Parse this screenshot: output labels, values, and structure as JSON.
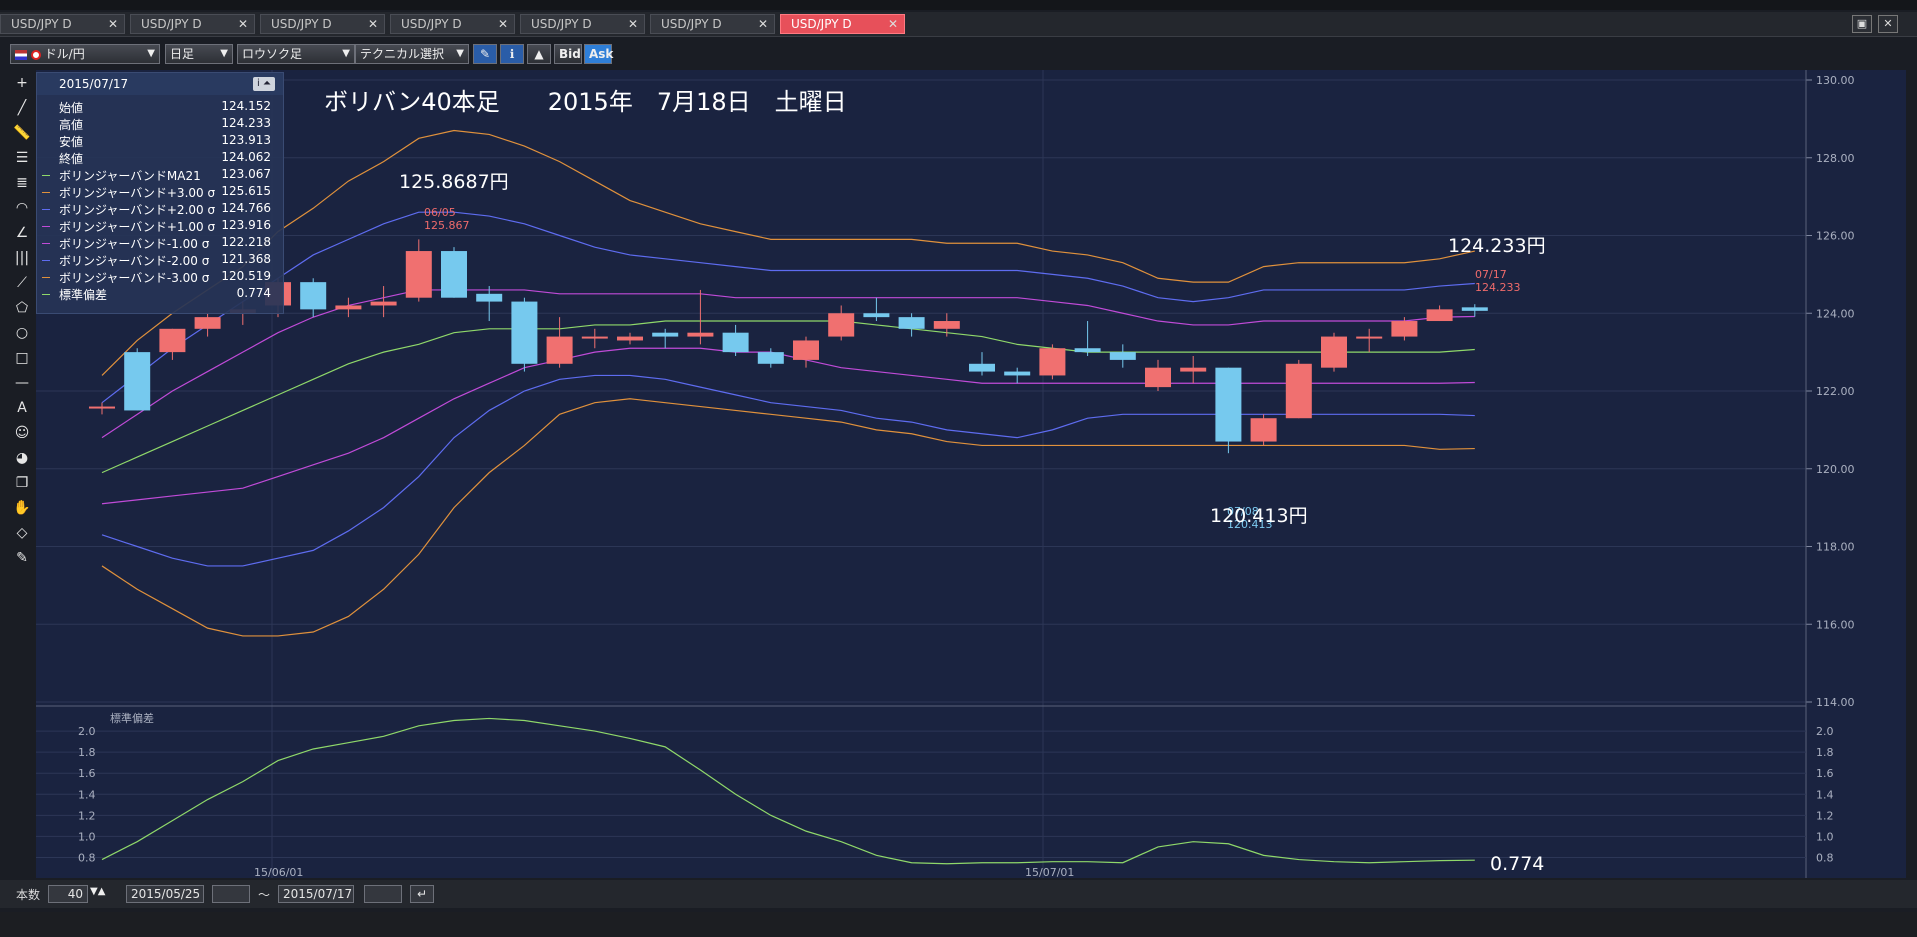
{
  "tabs": [
    {
      "label": "USD/JPY D",
      "active": false
    },
    {
      "label": "USD/JPY D",
      "active": false
    },
    {
      "label": "USD/JPY D",
      "active": false
    },
    {
      "label": "USD/JPY D",
      "active": false
    },
    {
      "label": "USD/JPY D",
      "active": false
    },
    {
      "label": "USD/JPY D",
      "active": false
    },
    {
      "label": "USD/JPY D",
      "active": true
    }
  ],
  "toolbar": {
    "pair": "ドル/円",
    "timeframe": "日足",
    "chart_type": "ロウソク足",
    "technical": "テクニカル選択",
    "bid": "Bid",
    "ask": "Ask"
  },
  "info_panel": {
    "date": "2015/07/17",
    "rows": [
      {
        "name": "始値",
        "value": "124.152",
        "color": ""
      },
      {
        "name": "高値",
        "value": "124.233",
        "color": ""
      },
      {
        "name": "安値",
        "value": "123.913",
        "color": ""
      },
      {
        "name": "終値",
        "value": "124.062",
        "color": ""
      },
      {
        "name": "ボリンジャーバンドMA21",
        "value": "123.067",
        "color": "#8fd86a"
      },
      {
        "name": "ボリンジャーバンド+3.00 σ",
        "value": "125.615",
        "color": "#e0913c"
      },
      {
        "name": "ボリンジャーバンド+2.00 σ",
        "value": "124.766",
        "color": "#5e6cf0"
      },
      {
        "name": "ボリンジャーバンド+1.00 σ",
        "value": "123.916",
        "color": "#c04bd8"
      },
      {
        "name": "ボリンジャーバンド-1.00 σ",
        "value": "122.218",
        "color": "#c04bd8"
      },
      {
        "name": "ボリンジャーバンド-2.00 σ",
        "value": "121.368",
        "color": "#5e6cf0"
      },
      {
        "name": "ボリンジャーバンド-3.00 σ",
        "value": "120.519",
        "color": "#e0913c"
      },
      {
        "name": "標準偏差",
        "value": "0.774",
        "color": "#8fd86a"
      }
    ]
  },
  "annotations": {
    "title": "ボリバン40本足　　2015年　7月18日　土曜日",
    "high_note": "125.8687円",
    "last_note": "124.233円",
    "low_note": "120.413円",
    "std_note": "0.774"
  },
  "chart_data": {
    "type": "candlestick",
    "instrument": "USD/JPY D",
    "price_axis": {
      "range": [
        114,
        130
      ],
      "ticks": [
        "130.00",
        "128.00",
        "126.00",
        "124.00",
        "122.00",
        "120.00",
        "118.00",
        "116.00",
        "114.00"
      ]
    },
    "x_labels": [
      "15/06/01",
      "15/07/01"
    ],
    "marks": {
      "high": {
        "date": "06/05",
        "value": "125.867"
      },
      "low": {
        "date": "07/08",
        "value": "120.413"
      },
      "last": {
        "date": "07/17",
        "value": "124.233"
      }
    },
    "candles": [
      {
        "o": 121.6,
        "h": 121.7,
        "l": 121.4,
        "c": 121.6
      },
      {
        "o": 123.0,
        "h": 123.1,
        "l": 121.5,
        "c": 121.5
      },
      {
        "o": 123.0,
        "h": 123.6,
        "l": 122.8,
        "c": 123.6
      },
      {
        "o": 123.6,
        "h": 124.0,
        "l": 123.4,
        "c": 123.9
      },
      {
        "o": 124.0,
        "h": 124.3,
        "l": 123.7,
        "c": 124.1
      },
      {
        "o": 124.2,
        "h": 124.9,
        "l": 123.9,
        "c": 124.8
      },
      {
        "o": 124.8,
        "h": 124.9,
        "l": 123.9,
        "c": 124.1
      },
      {
        "o": 124.1,
        "h": 124.4,
        "l": 123.9,
        "c": 124.2
      },
      {
        "o": 124.2,
        "h": 124.7,
        "l": 123.9,
        "c": 124.3
      },
      {
        "o": 124.4,
        "h": 125.9,
        "l": 124.3,
        "c": 125.6
      },
      {
        "o": 125.6,
        "h": 125.7,
        "l": 124.4,
        "c": 124.4
      },
      {
        "o": 124.5,
        "h": 124.7,
        "l": 123.8,
        "c": 124.3
      },
      {
        "o": 124.3,
        "h": 124.4,
        "l": 122.5,
        "c": 122.7
      },
      {
        "o": 122.7,
        "h": 123.9,
        "l": 122.6,
        "c": 123.4
      },
      {
        "o": 123.4,
        "h": 123.6,
        "l": 123.1,
        "c": 123.4
      },
      {
        "o": 123.3,
        "h": 123.5,
        "l": 123.2,
        "c": 123.4
      },
      {
        "o": 123.5,
        "h": 123.6,
        "l": 123.1,
        "c": 123.4
      },
      {
        "o": 123.4,
        "h": 124.6,
        "l": 123.2,
        "c": 123.5
      },
      {
        "o": 123.5,
        "h": 123.7,
        "l": 122.9,
        "c": 123.0
      },
      {
        "o": 123.0,
        "h": 123.1,
        "l": 122.6,
        "c": 122.7
      },
      {
        "o": 122.8,
        "h": 123.4,
        "l": 122.6,
        "c": 123.3
      },
      {
        "o": 123.4,
        "h": 124.2,
        "l": 123.3,
        "c": 124.0
      },
      {
        "o": 124.0,
        "h": 124.4,
        "l": 123.8,
        "c": 123.9
      },
      {
        "o": 123.9,
        "h": 124.0,
        "l": 123.4,
        "c": 123.6
      },
      {
        "o": 123.6,
        "h": 124.0,
        "l": 123.4,
        "c": 123.8
      },
      {
        "o": 122.7,
        "h": 123.0,
        "l": 122.4,
        "c": 122.5
      },
      {
        "o": 122.5,
        "h": 122.6,
        "l": 122.2,
        "c": 122.4
      },
      {
        "o": 122.4,
        "h": 123.2,
        "l": 122.3,
        "c": 123.1
      },
      {
        "o": 123.1,
        "h": 123.8,
        "l": 122.9,
        "c": 123.0
      },
      {
        "o": 123.0,
        "h": 123.2,
        "l": 122.6,
        "c": 122.8
      },
      {
        "o": 122.1,
        "h": 122.8,
        "l": 122.0,
        "c": 122.6
      },
      {
        "o": 122.5,
        "h": 122.9,
        "l": 122.2,
        "c": 122.6
      },
      {
        "o": 122.6,
        "h": 122.6,
        "l": 120.4,
        "c": 120.7
      },
      {
        "o": 120.7,
        "h": 121.4,
        "l": 120.6,
        "c": 121.3
      },
      {
        "o": 121.3,
        "h": 122.8,
        "l": 121.3,
        "c": 122.7
      },
      {
        "o": 122.6,
        "h": 123.5,
        "l": 122.5,
        "c": 123.4
      },
      {
        "o": 123.4,
        "h": 123.6,
        "l": 123.0,
        "c": 123.4
      },
      {
        "o": 123.4,
        "h": 123.9,
        "l": 123.3,
        "c": 123.8
      },
      {
        "o": 123.8,
        "h": 124.2,
        "l": 123.8,
        "c": 124.1
      },
      {
        "o": 124.152,
        "h": 124.233,
        "l": 123.913,
        "c": 124.062
      }
    ],
    "bands": {
      "plus3": [
        122.4,
        123.3,
        124.0,
        124.6,
        125.2,
        126.1,
        126.7,
        127.4,
        127.9,
        128.5,
        128.7,
        128.6,
        128.3,
        127.9,
        127.4,
        126.9,
        126.6,
        126.3,
        126.1,
        125.9,
        125.9,
        125.9,
        125.9,
        125.9,
        125.8,
        125.8,
        125.8,
        125.6,
        125.5,
        125.3,
        124.9,
        124.8,
        124.8,
        125.2,
        125.3,
        125.3,
        125.3,
        125.3,
        125.4,
        125.6
      ],
      "plus2": [
        121.7,
        122.4,
        123.1,
        123.7,
        124.3,
        124.9,
        125.5,
        125.9,
        126.3,
        126.6,
        126.6,
        126.5,
        126.3,
        126.0,
        125.7,
        125.5,
        125.4,
        125.3,
        125.2,
        125.1,
        125.1,
        125.1,
        125.1,
        125.1,
        125.1,
        125.1,
        125.1,
        125.0,
        124.9,
        124.7,
        124.4,
        124.3,
        124.4,
        124.6,
        124.6,
        124.6,
        124.6,
        124.6,
        124.7,
        124.766
      ],
      "plus1": [
        120.8,
        121.4,
        122.0,
        122.5,
        123.0,
        123.5,
        123.9,
        124.2,
        124.4,
        124.6,
        124.6,
        124.6,
        124.6,
        124.5,
        124.5,
        124.5,
        124.5,
        124.5,
        124.4,
        124.4,
        124.4,
        124.4,
        124.4,
        124.4,
        124.4,
        124.4,
        124.4,
        124.3,
        124.2,
        124.0,
        123.8,
        123.7,
        123.7,
        123.8,
        123.8,
        123.8,
        123.8,
        123.8,
        123.9,
        123.916
      ],
      "ma": [
        119.9,
        120.3,
        120.7,
        121.1,
        121.5,
        121.9,
        122.3,
        122.7,
        123.0,
        123.2,
        123.5,
        123.6,
        123.6,
        123.6,
        123.7,
        123.7,
        123.8,
        123.8,
        123.8,
        123.8,
        123.8,
        123.8,
        123.7,
        123.6,
        123.5,
        123.4,
        123.2,
        123.1,
        123.0,
        123.0,
        123.0,
        123.0,
        123.0,
        123.0,
        123.0,
        123.0,
        123.0,
        123.0,
        123.0,
        123.067
      ],
      "minus1": [
        119.1,
        119.2,
        119.3,
        119.4,
        119.5,
        119.8,
        120.1,
        120.4,
        120.8,
        121.3,
        121.8,
        122.2,
        122.6,
        122.8,
        123.0,
        123.1,
        123.1,
        123.1,
        123.0,
        123.0,
        122.8,
        122.6,
        122.5,
        122.4,
        122.3,
        122.2,
        122.2,
        122.2,
        122.2,
        122.2,
        122.2,
        122.2,
        122.2,
        122.2,
        122.2,
        122.2,
        122.2,
        122.2,
        122.2,
        122.218
      ],
      "minus2": [
        118.3,
        118.0,
        117.7,
        117.5,
        117.5,
        117.7,
        117.9,
        118.4,
        119.0,
        119.8,
        120.8,
        121.5,
        122.0,
        122.3,
        122.4,
        122.4,
        122.3,
        122.1,
        121.9,
        121.7,
        121.6,
        121.5,
        121.3,
        121.2,
        121.0,
        120.9,
        120.8,
        121.0,
        121.3,
        121.4,
        121.4,
        121.4,
        121.4,
        121.4,
        121.4,
        121.4,
        121.4,
        121.4,
        121.4,
        121.368
      ],
      "minus3": [
        117.5,
        116.9,
        116.4,
        115.9,
        115.7,
        115.7,
        115.8,
        116.2,
        116.9,
        117.8,
        119.0,
        119.9,
        120.6,
        121.4,
        121.7,
        121.8,
        121.7,
        121.6,
        121.5,
        121.4,
        121.3,
        121.2,
        121.0,
        120.9,
        120.7,
        120.6,
        120.6,
        120.6,
        120.6,
        120.6,
        120.6,
        120.6,
        120.6,
        120.6,
        120.6,
        120.6,
        120.6,
        120.6,
        120.5,
        120.519
      ]
    },
    "std_panel": {
      "label": "標準偏差",
      "range": [
        0.7,
        2.2
      ],
      "ticks": [
        "2.0",
        "1.8",
        "1.6",
        "1.4",
        "1.2",
        "1.0",
        "0.8"
      ],
      "values": [
        0.78,
        0.95,
        1.15,
        1.35,
        1.52,
        1.72,
        1.83,
        1.89,
        1.95,
        2.05,
        2.1,
        2.12,
        2.1,
        2.05,
        2.0,
        1.93,
        1.85,
        1.63,
        1.4,
        1.2,
        1.05,
        0.95,
        0.82,
        0.75,
        0.74,
        0.75,
        0.75,
        0.76,
        0.76,
        0.75,
        0.9,
        0.95,
        0.93,
        0.82,
        0.78,
        0.76,
        0.75,
        0.76,
        0.77,
        0.774
      ]
    }
  },
  "bottom": {
    "count_label": "本数",
    "count_value": "40",
    "date_from": "2015/05/25",
    "sep": "〜",
    "date_to": "2015/07/17"
  }
}
